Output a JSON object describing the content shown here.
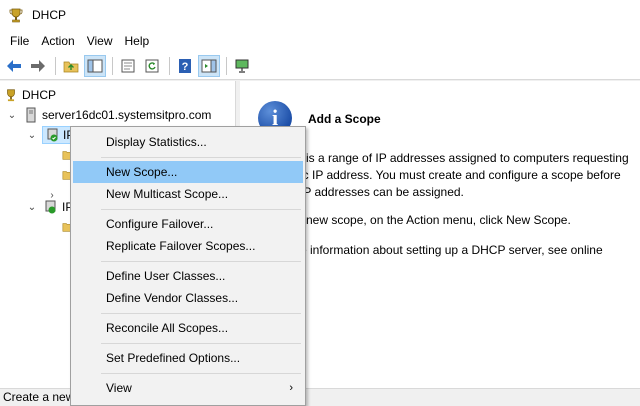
{
  "window": {
    "title": "DHCP"
  },
  "menubar": {
    "items": [
      "File",
      "Action",
      "View",
      "Help"
    ]
  },
  "toolbar": {
    "buttons": [
      "back-arrow-icon",
      "forward-arrow-icon",
      "up-folder-icon",
      "show-hide-tree-icon",
      "properties-icon",
      "refresh-icon",
      "help-icon",
      "action-pane-icon",
      "computer-monitor-icon"
    ]
  },
  "tree": {
    "root": "DHCP",
    "server": "server16dc01.systemsitpro.com",
    "ipv4_partial": "IP",
    "ipv6_partial": "IP"
  },
  "content": {
    "title": "Add a Scope",
    "para1_lines": [
      "is a range of IP addresses assigned to computers requesting",
      "ic IP address. You must create and configure a scope before",
      "IP addresses can be assigned."
    ],
    "para2_lines": [
      "new scope, on the Action menu, click New Scope."
    ],
    "para3_lines": [
      "e information about setting up a DHCP server, see online"
    ]
  },
  "context_menu": {
    "items": [
      {
        "label": "Display Statistics..."
      },
      {
        "label": "New Scope...",
        "highlighted": true
      },
      {
        "label": "New Multicast Scope..."
      },
      {
        "label": "Configure Failover..."
      },
      {
        "label": "Replicate Failover Scopes..."
      },
      {
        "label": "Define User Classes..."
      },
      {
        "label": "Define Vendor Classes..."
      },
      {
        "label": "Reconcile All Scopes..."
      },
      {
        "label": "Set Predefined Options..."
      },
      {
        "label": "View",
        "submenu_arrow": "›"
      }
    ]
  },
  "statusbar": {
    "text": "Create a new"
  },
  "colors": {
    "highlight": "#91c9f7",
    "selection": "#cce8ff",
    "accent_blue": "#1d4fa8"
  }
}
